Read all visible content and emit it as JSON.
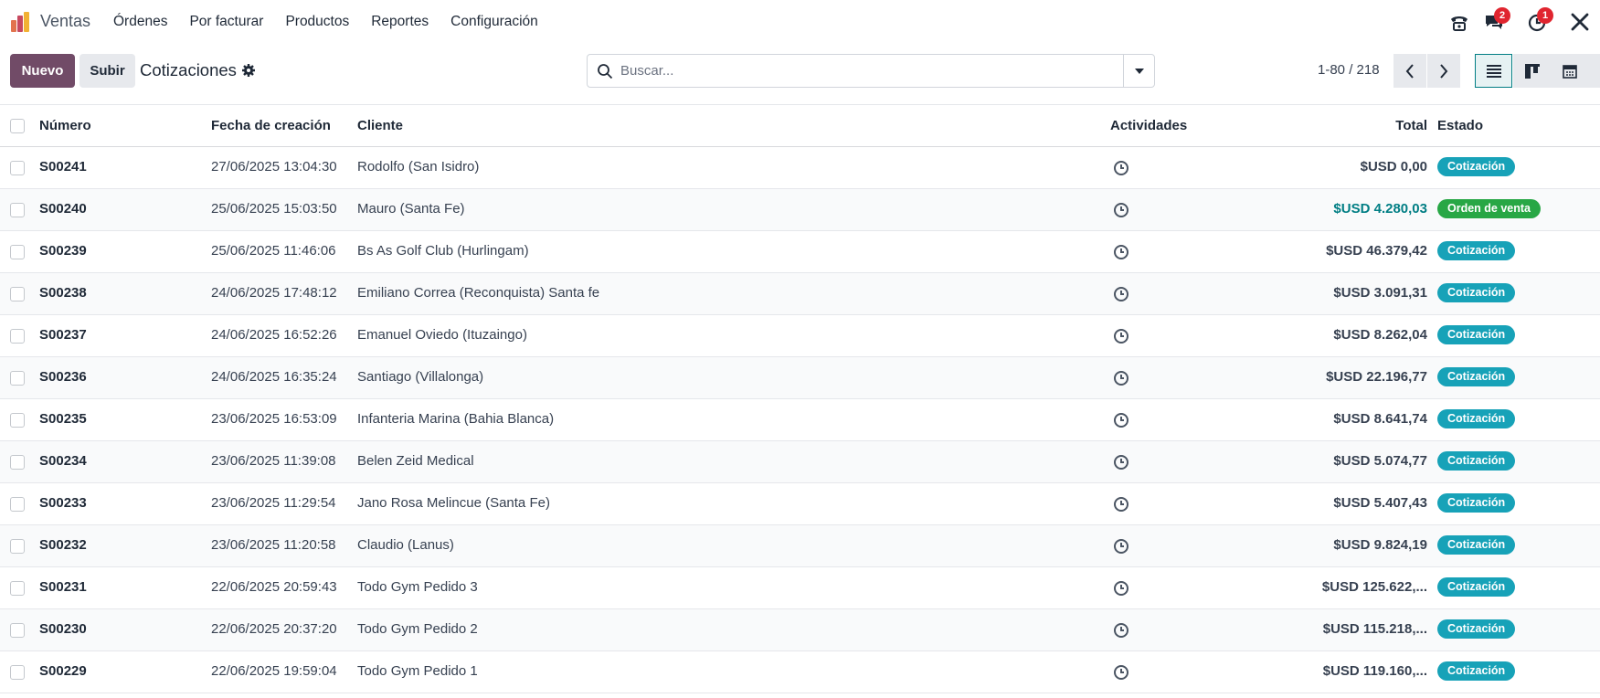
{
  "app": {
    "name": "Ventas",
    "menu": [
      "Órdenes",
      "Por facturar",
      "Productos",
      "Reportes",
      "Configuración"
    ],
    "badges": {
      "chat": "2",
      "activities": "1"
    }
  },
  "control": {
    "new_label": "Nuevo",
    "upload_label": "Subir",
    "title": "Cotizaciones",
    "search_placeholder": "Buscar...",
    "pager": "1-80 / 218"
  },
  "colors": {
    "primary": "#714b67",
    "accent": "#017e84",
    "quote": "#17a2b8",
    "order": "#28a745"
  },
  "table": {
    "headers": {
      "number": "Número",
      "date": "Fecha de creación",
      "client": "Cliente",
      "activities": "Actividades",
      "total": "Total",
      "state": "Estado"
    },
    "rows": [
      {
        "number": "S00241",
        "date": "27/06/2025 13:04:30",
        "client": "Rodolfo (San Isidro)",
        "total": "$USD 0,00",
        "state": "Cotización",
        "state_type": "quote"
      },
      {
        "number": "S00240",
        "date": "25/06/2025 15:03:50",
        "client": "Mauro (Santa Fe)",
        "total": "$USD 4.280,03",
        "state": "Orden de venta",
        "state_type": "order"
      },
      {
        "number": "S00239",
        "date": "25/06/2025 11:46:06",
        "client": "Bs As Golf Club (Hurlingam)",
        "total": "$USD 46.379,42",
        "state": "Cotización",
        "state_type": "quote"
      },
      {
        "number": "S00238",
        "date": "24/06/2025 17:48:12",
        "client": "Emiliano Correa (Reconquista) Santa fe",
        "total": "$USD 3.091,31",
        "state": "Cotización",
        "state_type": "quote"
      },
      {
        "number": "S00237",
        "date": "24/06/2025 16:52:26",
        "client": "Emanuel Oviedo (Ituzaingo)",
        "total": "$USD 8.262,04",
        "state": "Cotización",
        "state_type": "quote"
      },
      {
        "number": "S00236",
        "date": "24/06/2025 16:35:24",
        "client": "Santiago (Villalonga)",
        "total": "$USD 22.196,77",
        "state": "Cotización",
        "state_type": "quote"
      },
      {
        "number": "S00235",
        "date": "23/06/2025 16:53:09",
        "client": "Infanteria Marina (Bahia Blanca)",
        "total": "$USD 8.641,74",
        "state": "Cotización",
        "state_type": "quote"
      },
      {
        "number": "S00234",
        "date": "23/06/2025 11:39:08",
        "client": "Belen Zeid Medical",
        "total": "$USD 5.074,77",
        "state": "Cotización",
        "state_type": "quote"
      },
      {
        "number": "S00233",
        "date": "23/06/2025 11:29:54",
        "client": "Jano Rosa Melincue (Santa Fe)",
        "total": "$USD 5.407,43",
        "state": "Cotización",
        "state_type": "quote"
      },
      {
        "number": "S00232",
        "date": "23/06/2025 11:20:58",
        "client": "Claudio (Lanus)",
        "total": "$USD 9.824,19",
        "state": "Cotización",
        "state_type": "quote"
      },
      {
        "number": "S00231",
        "date": "22/06/2025 20:59:43",
        "client": "Todo Gym Pedido 3",
        "total": "$USD 125.622,...",
        "state": "Cotización",
        "state_type": "quote"
      },
      {
        "number": "S00230",
        "date": "22/06/2025 20:37:20",
        "client": "Todo Gym Pedido 2",
        "total": "$USD 115.218,...",
        "state": "Cotización",
        "state_type": "quote"
      },
      {
        "number": "S00229",
        "date": "22/06/2025 19:59:04",
        "client": "Todo Gym Pedido 1",
        "total": "$USD 119.160,...",
        "state": "Cotización",
        "state_type": "quote"
      }
    ]
  }
}
